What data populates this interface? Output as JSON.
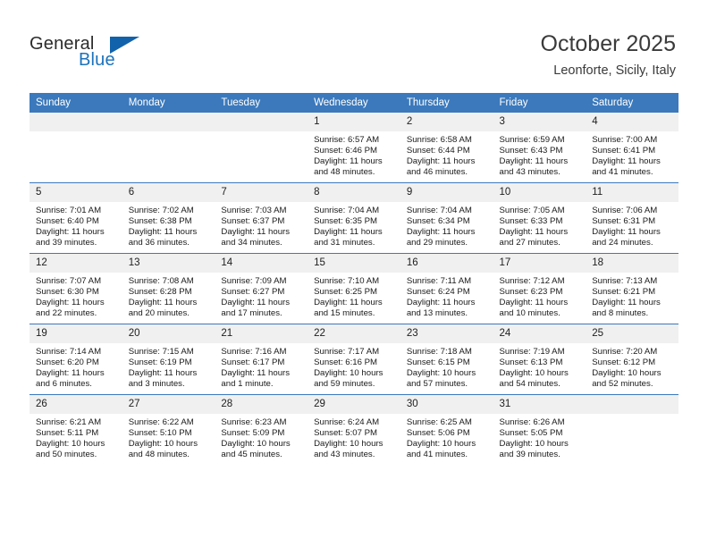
{
  "brand": {
    "name_part1": "General",
    "name_part2": "Blue"
  },
  "header": {
    "title": "October 2025",
    "subtitle": "Leonforte, Sicily, Italy"
  },
  "colors": {
    "header_blue": "#3b79bc",
    "brand_blue": "#1262ab",
    "daynum_bg": "#f0f0f0"
  },
  "weekdays": [
    "Sunday",
    "Monday",
    "Tuesday",
    "Wednesday",
    "Thursday",
    "Friday",
    "Saturday"
  ],
  "weeks": [
    [
      {
        "day": "",
        "blank": true
      },
      {
        "day": "",
        "blank": true
      },
      {
        "day": "",
        "blank": true
      },
      {
        "day": "1",
        "sunrise": "Sunrise: 6:57 AM",
        "sunset": "Sunset: 6:46 PM",
        "daylight1": "Daylight: 11 hours",
        "daylight2": "and 48 minutes."
      },
      {
        "day": "2",
        "sunrise": "Sunrise: 6:58 AM",
        "sunset": "Sunset: 6:44 PM",
        "daylight1": "Daylight: 11 hours",
        "daylight2": "and 46 minutes."
      },
      {
        "day": "3",
        "sunrise": "Sunrise: 6:59 AM",
        "sunset": "Sunset: 6:43 PM",
        "daylight1": "Daylight: 11 hours",
        "daylight2": "and 43 minutes."
      },
      {
        "day": "4",
        "sunrise": "Sunrise: 7:00 AM",
        "sunset": "Sunset: 6:41 PM",
        "daylight1": "Daylight: 11 hours",
        "daylight2": "and 41 minutes."
      }
    ],
    [
      {
        "day": "5",
        "sunrise": "Sunrise: 7:01 AM",
        "sunset": "Sunset: 6:40 PM",
        "daylight1": "Daylight: 11 hours",
        "daylight2": "and 39 minutes."
      },
      {
        "day": "6",
        "sunrise": "Sunrise: 7:02 AM",
        "sunset": "Sunset: 6:38 PM",
        "daylight1": "Daylight: 11 hours",
        "daylight2": "and 36 minutes."
      },
      {
        "day": "7",
        "sunrise": "Sunrise: 7:03 AM",
        "sunset": "Sunset: 6:37 PM",
        "daylight1": "Daylight: 11 hours",
        "daylight2": "and 34 minutes."
      },
      {
        "day": "8",
        "sunrise": "Sunrise: 7:04 AM",
        "sunset": "Sunset: 6:35 PM",
        "daylight1": "Daylight: 11 hours",
        "daylight2": "and 31 minutes."
      },
      {
        "day": "9",
        "sunrise": "Sunrise: 7:04 AM",
        "sunset": "Sunset: 6:34 PM",
        "daylight1": "Daylight: 11 hours",
        "daylight2": "and 29 minutes."
      },
      {
        "day": "10",
        "sunrise": "Sunrise: 7:05 AM",
        "sunset": "Sunset: 6:33 PM",
        "daylight1": "Daylight: 11 hours",
        "daylight2": "and 27 minutes."
      },
      {
        "day": "11",
        "sunrise": "Sunrise: 7:06 AM",
        "sunset": "Sunset: 6:31 PM",
        "daylight1": "Daylight: 11 hours",
        "daylight2": "and 24 minutes."
      }
    ],
    [
      {
        "day": "12",
        "sunrise": "Sunrise: 7:07 AM",
        "sunset": "Sunset: 6:30 PM",
        "daylight1": "Daylight: 11 hours",
        "daylight2": "and 22 minutes."
      },
      {
        "day": "13",
        "sunrise": "Sunrise: 7:08 AM",
        "sunset": "Sunset: 6:28 PM",
        "daylight1": "Daylight: 11 hours",
        "daylight2": "and 20 minutes."
      },
      {
        "day": "14",
        "sunrise": "Sunrise: 7:09 AM",
        "sunset": "Sunset: 6:27 PM",
        "daylight1": "Daylight: 11 hours",
        "daylight2": "and 17 minutes."
      },
      {
        "day": "15",
        "sunrise": "Sunrise: 7:10 AM",
        "sunset": "Sunset: 6:25 PM",
        "daylight1": "Daylight: 11 hours",
        "daylight2": "and 15 minutes."
      },
      {
        "day": "16",
        "sunrise": "Sunrise: 7:11 AM",
        "sunset": "Sunset: 6:24 PM",
        "daylight1": "Daylight: 11 hours",
        "daylight2": "and 13 minutes."
      },
      {
        "day": "17",
        "sunrise": "Sunrise: 7:12 AM",
        "sunset": "Sunset: 6:23 PM",
        "daylight1": "Daylight: 11 hours",
        "daylight2": "and 10 minutes."
      },
      {
        "day": "18",
        "sunrise": "Sunrise: 7:13 AM",
        "sunset": "Sunset: 6:21 PM",
        "daylight1": "Daylight: 11 hours",
        "daylight2": "and 8 minutes."
      }
    ],
    [
      {
        "day": "19",
        "sunrise": "Sunrise: 7:14 AM",
        "sunset": "Sunset: 6:20 PM",
        "daylight1": "Daylight: 11 hours",
        "daylight2": "and 6 minutes."
      },
      {
        "day": "20",
        "sunrise": "Sunrise: 7:15 AM",
        "sunset": "Sunset: 6:19 PM",
        "daylight1": "Daylight: 11 hours",
        "daylight2": "and 3 minutes."
      },
      {
        "day": "21",
        "sunrise": "Sunrise: 7:16 AM",
        "sunset": "Sunset: 6:17 PM",
        "daylight1": "Daylight: 11 hours",
        "daylight2": "and 1 minute."
      },
      {
        "day": "22",
        "sunrise": "Sunrise: 7:17 AM",
        "sunset": "Sunset: 6:16 PM",
        "daylight1": "Daylight: 10 hours",
        "daylight2": "and 59 minutes."
      },
      {
        "day": "23",
        "sunrise": "Sunrise: 7:18 AM",
        "sunset": "Sunset: 6:15 PM",
        "daylight1": "Daylight: 10 hours",
        "daylight2": "and 57 minutes."
      },
      {
        "day": "24",
        "sunrise": "Sunrise: 7:19 AM",
        "sunset": "Sunset: 6:13 PM",
        "daylight1": "Daylight: 10 hours",
        "daylight2": "and 54 minutes."
      },
      {
        "day": "25",
        "sunrise": "Sunrise: 7:20 AM",
        "sunset": "Sunset: 6:12 PM",
        "daylight1": "Daylight: 10 hours",
        "daylight2": "and 52 minutes."
      }
    ],
    [
      {
        "day": "26",
        "sunrise": "Sunrise: 6:21 AM",
        "sunset": "Sunset: 5:11 PM",
        "daylight1": "Daylight: 10 hours",
        "daylight2": "and 50 minutes."
      },
      {
        "day": "27",
        "sunrise": "Sunrise: 6:22 AM",
        "sunset": "Sunset: 5:10 PM",
        "daylight1": "Daylight: 10 hours",
        "daylight2": "and 48 minutes."
      },
      {
        "day": "28",
        "sunrise": "Sunrise: 6:23 AM",
        "sunset": "Sunset: 5:09 PM",
        "daylight1": "Daylight: 10 hours",
        "daylight2": "and 45 minutes."
      },
      {
        "day": "29",
        "sunrise": "Sunrise: 6:24 AM",
        "sunset": "Sunset: 5:07 PM",
        "daylight1": "Daylight: 10 hours",
        "daylight2": "and 43 minutes."
      },
      {
        "day": "30",
        "sunrise": "Sunrise: 6:25 AM",
        "sunset": "Sunset: 5:06 PM",
        "daylight1": "Daylight: 10 hours",
        "daylight2": "and 41 minutes."
      },
      {
        "day": "31",
        "sunrise": "Sunrise: 6:26 AM",
        "sunset": "Sunset: 5:05 PM",
        "daylight1": "Daylight: 10 hours",
        "daylight2": "and 39 minutes."
      },
      {
        "day": "",
        "blank": true
      }
    ]
  ]
}
